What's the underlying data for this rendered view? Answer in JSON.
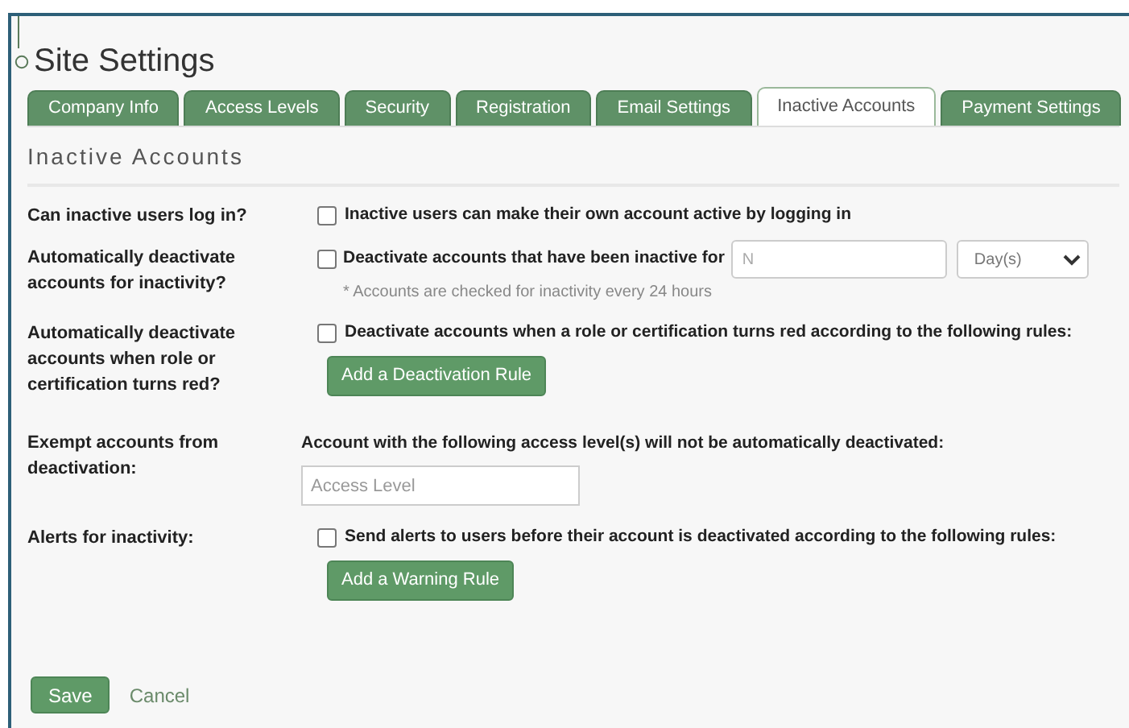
{
  "title": "Site Settings",
  "tabs": [
    {
      "label": "Company Info",
      "selected": false
    },
    {
      "label": "Access Levels",
      "selected": false
    },
    {
      "label": "Security",
      "selected": false
    },
    {
      "label": "Registration",
      "selected": false
    },
    {
      "label": "Email Settings",
      "selected": false
    },
    {
      "label": "Inactive Accounts",
      "selected": true
    },
    {
      "label": "Payment Settings",
      "selected": false
    }
  ],
  "section_title": "Inactive Accounts",
  "settings": [
    {
      "kind": "checkbox",
      "label": "Can inactive users log in?",
      "option": "Inactive users can make their own account active by logging in",
      "checked": false
    },
    {
      "kind": "period",
      "label": "Automatically deactivate accounts for inactivity?",
      "option": "Deactivate accounts that have been inactive for",
      "checked": false,
      "placeholder": "N",
      "unit": "Day(s)",
      "note": "* Accounts are checked for inactivity every 24 hours"
    },
    {
      "kind": "rule",
      "label": "Automatically deactivate accounts when role or certification turns red?",
      "option": "Deactivate accounts when a role or certification turns red according to the following rules:",
      "checked": false,
      "button": "Add a Deactivation Rule"
    },
    {
      "kind": "lookup",
      "label": "Exempt accounts from deactivation:",
      "text": "Account with the following access level(s) will not be automatically deactivated:",
      "placeholder": "Access Level"
    },
    {
      "kind": "rule",
      "label": "Alerts for inactivity:",
      "option": "Send alerts to users before their account is deactivated according to the following rules:",
      "checked": false,
      "button": "Add a Warning Rule"
    }
  ],
  "actions": {
    "save": "Save",
    "cancel": "Cancel"
  }
}
